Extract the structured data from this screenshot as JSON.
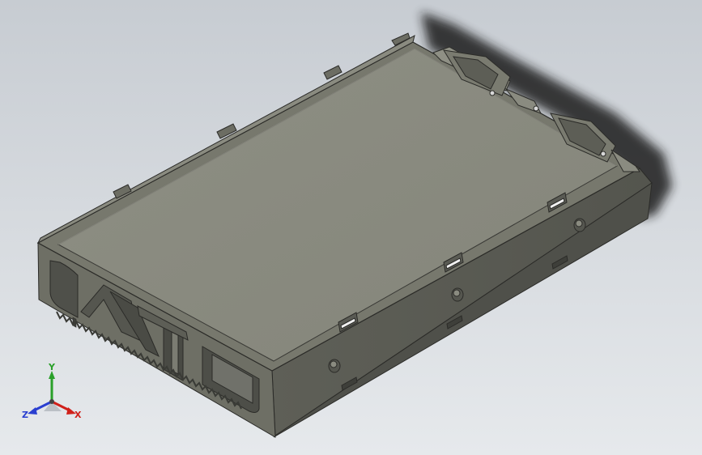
{
  "viewport": {
    "background_top": "#c7ccd2",
    "background_bottom": "#e6e9ec"
  },
  "model": {
    "body_color": "#7e7f74",
    "top_color": "#8b8c80",
    "side_color": "#5c5d55",
    "front_color": "#6a6b61",
    "edge_color": "#2b2b28"
  },
  "triad": {
    "x_label": "X",
    "y_label": "Y",
    "z_label": "Z",
    "x_color": "#d0201a",
    "y_color": "#2aa02a",
    "z_color": "#2a3fd0"
  }
}
